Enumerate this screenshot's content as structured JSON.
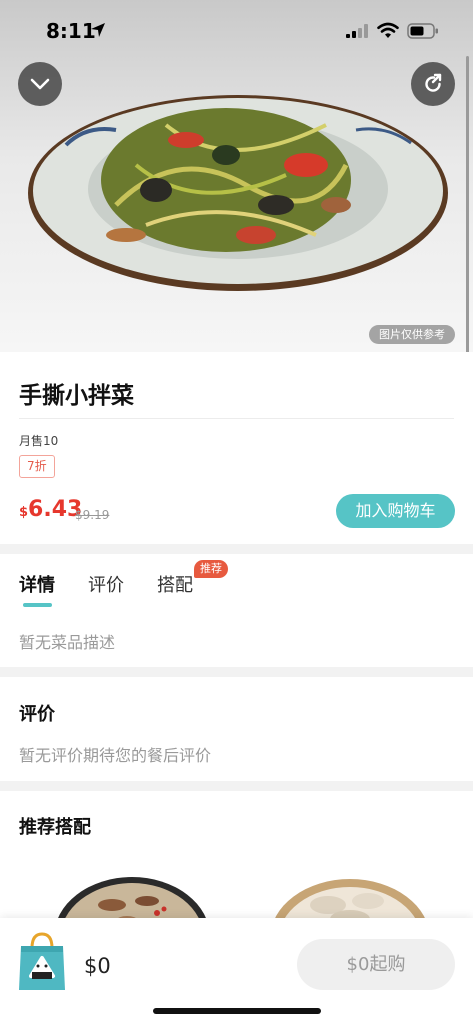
{
  "status_bar": {
    "time": "8:11"
  },
  "hero": {
    "reference_tag": "图片仅供参考"
  },
  "product": {
    "name": "手撕小拌菜",
    "monthly_sales": "月售10",
    "discount": "7折",
    "currency": "$",
    "price": "6.43",
    "original_price": "$9.19",
    "add_to_cart": "加入购物车"
  },
  "tabs": {
    "items": [
      {
        "label": "详情"
      },
      {
        "label": "评价"
      },
      {
        "label": "搭配"
      }
    ],
    "active": "详情",
    "badge": "推荐",
    "details_text": "暂无菜品描述"
  },
  "reviews": {
    "title": "评价",
    "empty_text": "暂无评价期待您的餐后评价"
  },
  "recommended": {
    "title": "推荐搭配"
  },
  "cart": {
    "total": "$0",
    "checkout_label": "$0起购"
  },
  "colors": {
    "accent": "#56c4c6",
    "price_red": "#e6372d",
    "badge_red": "#e75a3f"
  },
  "icons": [
    "location-arrow-icon",
    "signal-icon",
    "wifi-icon",
    "battery-icon",
    "chevron-down-icon",
    "share-icon",
    "shopping-bag-icon"
  ]
}
